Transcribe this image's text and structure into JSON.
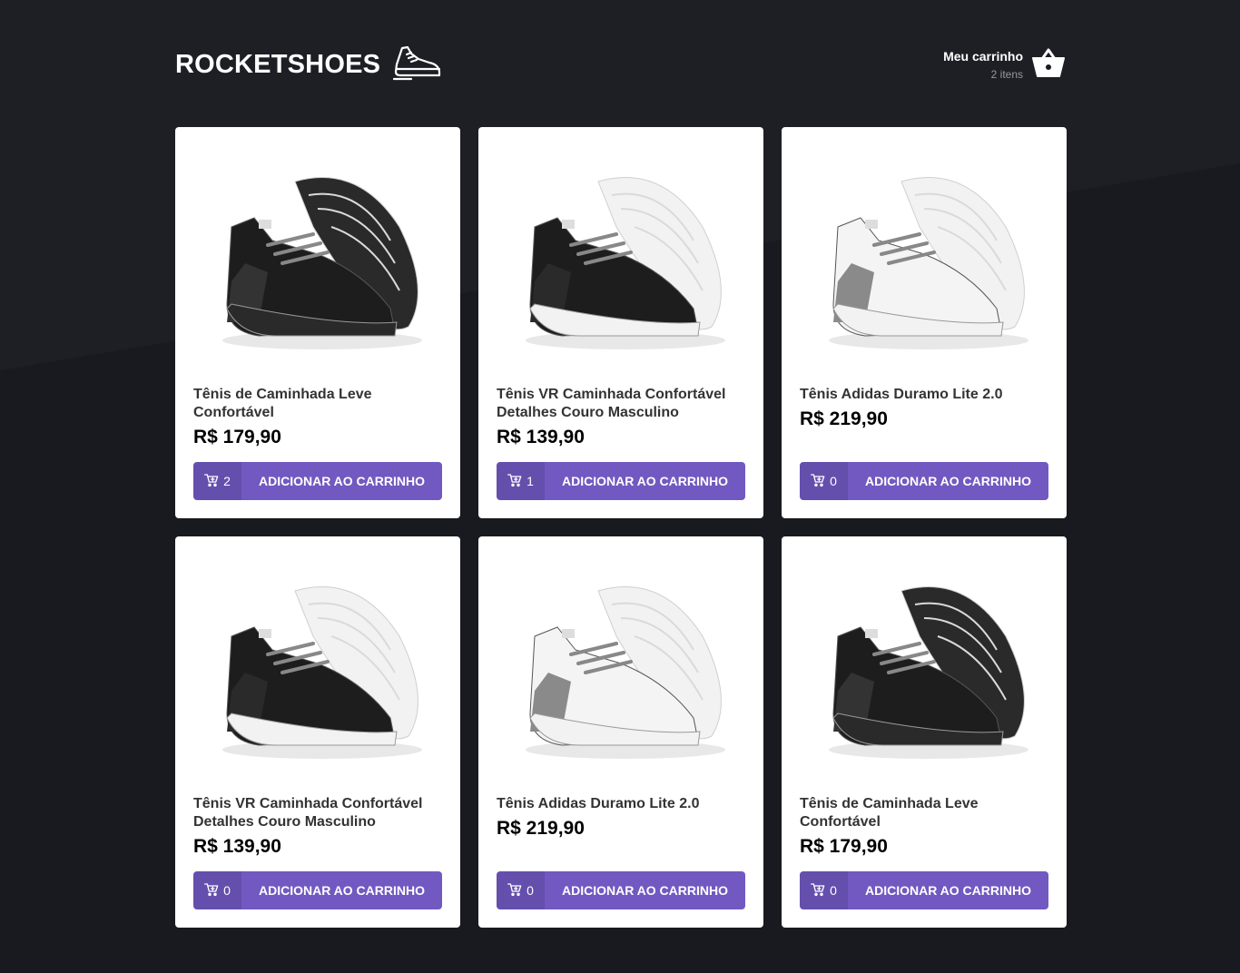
{
  "header": {
    "logo_text": "ROCKETSHOES",
    "logo_icon": "sneaker-icon",
    "cart_title": "Meu carrinho",
    "cart_count": "2 itens",
    "cart_icon": "basket-icon"
  },
  "colors": {
    "background": "#191920",
    "accent": "#7159c1",
    "card": "#ffffff"
  },
  "products": [
    {
      "title": "Tênis de Caminhada Leve Confortável",
      "price": "R$ 179,90",
      "qty": "2",
      "button": "ADICIONAR AO CARRINHO",
      "shoe_colors": {
        "upper": "#1d1d1d",
        "sole": "#2a2a2a",
        "accent": "#333333"
      }
    },
    {
      "title": "Tênis VR Caminhada Confortável Detalhes Couro Masculino",
      "price": "R$ 139,90",
      "qty": "1",
      "button": "ADICIONAR AO CARRINHO",
      "shoe_colors": {
        "upper": "#1d1d1d",
        "sole": "#f2f2f2",
        "accent": "#2a2a2a"
      }
    },
    {
      "title": "Tênis Adidas Duramo Lite 2.0",
      "price": "R$ 219,90",
      "qty": "0",
      "button": "ADICIONAR AO CARRINHO",
      "shoe_colors": {
        "upper": "#f4f4f4",
        "sole": "#f2f2f2",
        "accent": "#8a8a8a"
      }
    },
    {
      "title": "Tênis VR Caminhada Confortável Detalhes Couro Masculino",
      "price": "R$ 139,90",
      "qty": "0",
      "button": "ADICIONAR AO CARRINHO",
      "shoe_colors": {
        "upper": "#1d1d1d",
        "sole": "#f2f2f2",
        "accent": "#2a2a2a"
      }
    },
    {
      "title": "Tênis Adidas Duramo Lite 2.0",
      "price": "R$ 219,90",
      "qty": "0",
      "button": "ADICIONAR AO CARRINHO",
      "shoe_colors": {
        "upper": "#f4f4f4",
        "sole": "#f2f2f2",
        "accent": "#8a8a8a"
      }
    },
    {
      "title": "Tênis de Caminhada Leve Confortável",
      "price": "R$ 179,90",
      "qty": "0",
      "button": "ADICIONAR AO CARRINHO",
      "shoe_colors": {
        "upper": "#1d1d1d",
        "sole": "#2a2a2a",
        "accent": "#333333"
      }
    }
  ]
}
